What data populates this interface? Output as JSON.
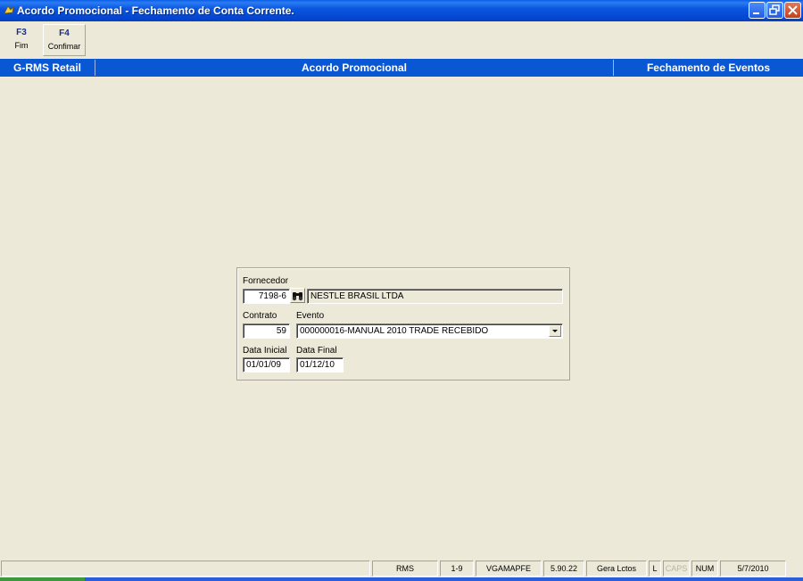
{
  "window": {
    "title": "Acordo Promocional - Fechamento de Conta Corrente."
  },
  "toolbar": {
    "buttons": [
      {
        "key": "F3",
        "label": "Fim"
      },
      {
        "key": "F4",
        "label": "Confimar"
      }
    ]
  },
  "header": {
    "left": "G-RMS Retail",
    "center": "Acordo Promocional",
    "right": "Fechamento de Eventos"
  },
  "form": {
    "fornecedor_label": "Fornecedor",
    "fornecedor_code": "7198-6",
    "fornecedor_name": "NESTLE BRASIL LTDA",
    "contrato_label": "Contrato",
    "contrato_value": "59",
    "evento_label": "Evento",
    "evento_value": "000000016-MANUAL 2010 TRADE RECEBIDO",
    "data_inicial_label": "Data Inicial",
    "data_inicial_value": "01/01/09",
    "data_final_label": "Data Final",
    "data_final_value": "01/12/10"
  },
  "statusbar": {
    "system": "RMS",
    "range": "1-9",
    "user": "VGAMAPFE",
    "version": "5.90.22",
    "module": "Gera Lctos",
    "l": "L",
    "caps": "CAPS",
    "num": "NUM",
    "date": "5/7/2010"
  },
  "icons": {
    "app": "app-icon",
    "search": "binoculars-icon",
    "dropdown": "chevron-down-icon"
  }
}
